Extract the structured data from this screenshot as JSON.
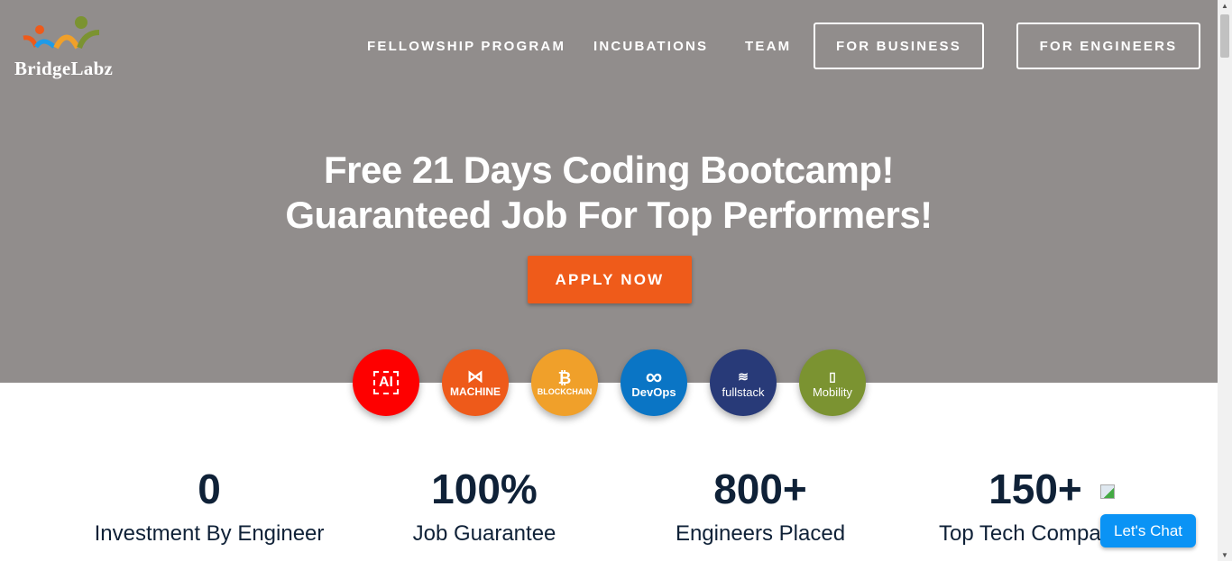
{
  "brand": {
    "name": "BridgeLabz"
  },
  "nav": {
    "links": [
      "FELLOWSHIP PROGRAM",
      "INCUBATIONS",
      "TEAM"
    ],
    "buttons": [
      "FOR BUSINESS",
      "FOR ENGINEERS"
    ]
  },
  "hero": {
    "line1": "Free 21 Days Coding Bootcamp!",
    "line2": "Guaranteed Job For Top Performers!",
    "cta": "APPLY NOW"
  },
  "tech": [
    {
      "label": "AI",
      "color": "#fe0000",
      "icon": "chip-icon"
    },
    {
      "label": "MACHINE",
      "color": "#ee5a1a",
      "icon": "network-icon"
    },
    {
      "label": "BLOCKCHAIN",
      "color": "#f0a02a",
      "icon": "bitcoin-icon"
    },
    {
      "label": "DevOps",
      "color": "#0a75c5",
      "icon": "infinity-icon"
    },
    {
      "label": "fullstack",
      "color": "#283a78",
      "icon": "layers-icon"
    },
    {
      "label": "Mobility",
      "color": "#7b9331",
      "icon": "mobile-code-icon"
    }
  ],
  "stats": [
    {
      "value": "0",
      "label": "Investment By Engineer"
    },
    {
      "value": "100%",
      "label": "Job Guarantee"
    },
    {
      "value": "800+",
      "label": "Engineers Placed"
    },
    {
      "value": "150+",
      "label": "Top Tech Companies"
    }
  ],
  "chat": {
    "label": "Let's Chat",
    "color": "#0a93f5"
  }
}
